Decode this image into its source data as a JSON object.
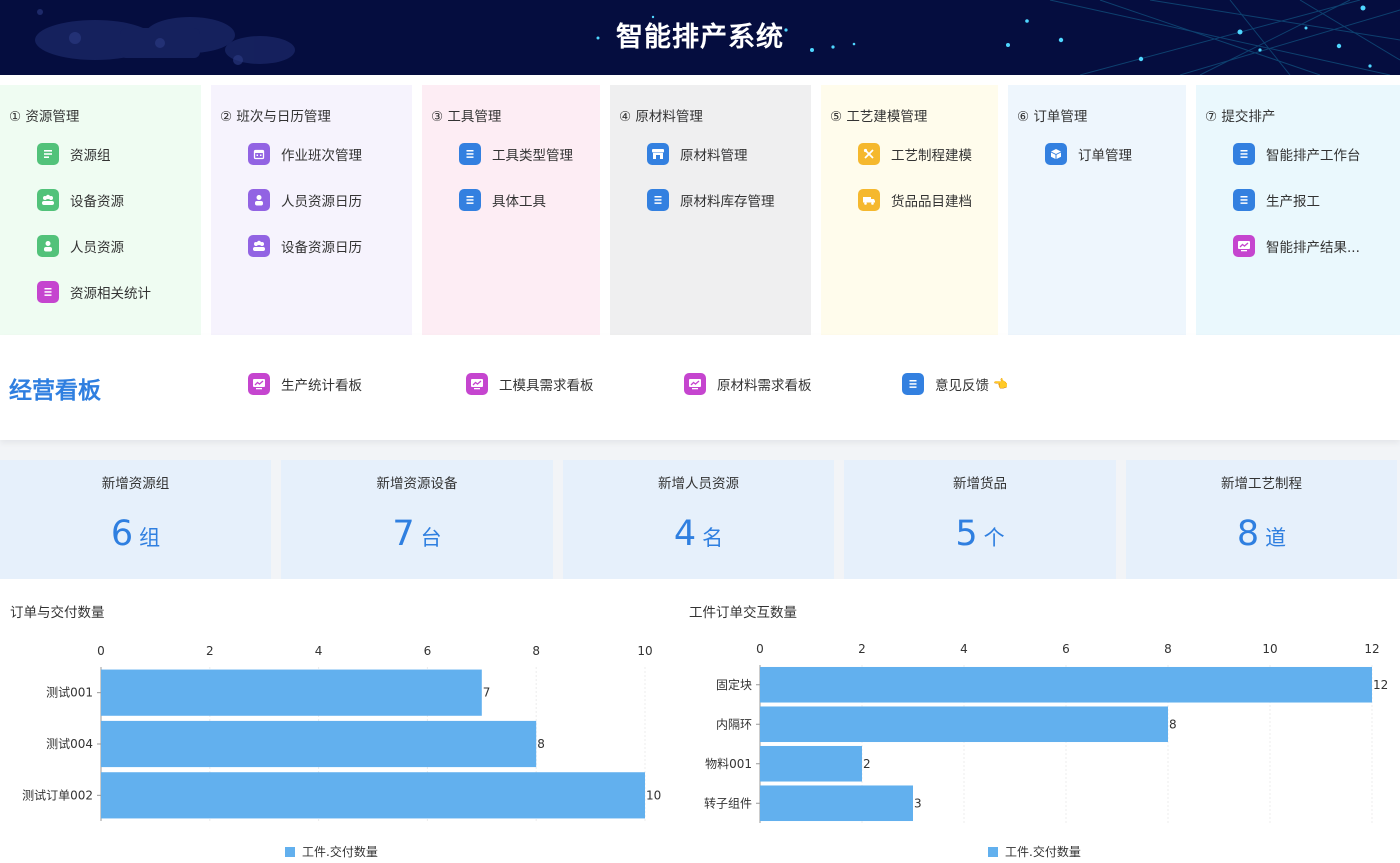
{
  "header": {
    "title": "智能排产系统"
  },
  "modules": [
    {
      "title": "① 资源管理",
      "bg": "#effcf2",
      "items": [
        {
          "label": "资源组",
          "icon": "list-icon",
          "color": "#52c27a"
        },
        {
          "label": "设备资源",
          "icon": "group-icon",
          "color": "#52c27a"
        },
        {
          "label": "人员资源",
          "icon": "person-icon",
          "color": "#52c27a"
        },
        {
          "label": "资源相关统计",
          "icon": "doc-icon",
          "color": "#c545cf"
        }
      ]
    },
    {
      "title": "② 班次与日历管理",
      "bg": "#f6f3fd",
      "items": [
        {
          "label": "作业班次管理",
          "icon": "calendar-icon",
          "color": "#9263e3"
        },
        {
          "label": "人员资源日历",
          "icon": "person-icon",
          "color": "#9263e3"
        },
        {
          "label": "设备资源日历",
          "icon": "group-icon",
          "color": "#9263e3"
        }
      ]
    },
    {
      "title": "③ 工具管理",
      "bg": "#fdedf4",
      "items": [
        {
          "label": "工具类型管理",
          "icon": "doc-icon",
          "color": "#3380e0"
        },
        {
          "label": "具体工具",
          "icon": "doc-icon",
          "color": "#3380e0"
        }
      ]
    },
    {
      "title": "④ 原材料管理",
      "bg": "#efeff0",
      "items": [
        {
          "label": "原材料管理",
          "icon": "store-icon",
          "color": "#3380e0"
        },
        {
          "label": "原材料库存管理",
          "icon": "doc-icon",
          "color": "#3380e0"
        }
      ]
    },
    {
      "title": "⑤ 工艺建模管理",
      "bg": "#fffcec",
      "items": [
        {
          "label": "工艺制程建模",
          "icon": "tools-icon",
          "color": "#f5b82e"
        },
        {
          "label": "货品品目建档",
          "icon": "truck-icon",
          "color": "#f5b82e"
        }
      ]
    },
    {
      "title": "⑥ 订单管理",
      "bg": "#eef6fd",
      "items": [
        {
          "label": "订单管理",
          "icon": "cube-icon",
          "color": "#3380e0"
        }
      ]
    },
    {
      "title": "⑦ 提交排产",
      "bg": "#eaf8fd",
      "items": [
        {
          "label": "智能排产工作台",
          "icon": "doc-icon",
          "color": "#3380e0"
        },
        {
          "label": "生产报工",
          "icon": "doc-icon",
          "color": "#3380e0"
        },
        {
          "label": "智能排产结果...",
          "icon": "monitor-icon",
          "color": "#c545cf"
        }
      ]
    }
  ],
  "board": {
    "title": "经营看板",
    "items": [
      {
        "label": "生产统计看板",
        "icon": "monitor-icon",
        "color": "#c545cf"
      },
      {
        "label": "工模具需求看板",
        "icon": "monitor-icon",
        "color": "#c545cf"
      },
      {
        "label": "原材料需求看板",
        "icon": "monitor-icon",
        "color": "#c545cf"
      },
      {
        "label": "意见反馈",
        "icon": "doc-icon",
        "color": "#3380e0",
        "emoji": "👈"
      }
    ]
  },
  "stats": [
    {
      "label": "新增资源组",
      "value": "6",
      "unit": "组"
    },
    {
      "label": "新增资源设备",
      "value": "7",
      "unit": "台"
    },
    {
      "label": "新增人员资源",
      "value": "4",
      "unit": "名"
    },
    {
      "label": "新增货品",
      "value": "5",
      "unit": "个"
    },
    {
      "label": "新增工艺制程",
      "value": "8",
      "unit": "道"
    }
  ],
  "chart_data": [
    {
      "type": "bar",
      "orientation": "horizontal",
      "title": "订单与交付数量",
      "categories": [
        "测试001",
        "测试004",
        "测试订单002"
      ],
      "series": [
        {
          "name": "工件.交付数量",
          "values": [
            7,
            8,
            10
          ]
        }
      ],
      "xlim": [
        0,
        10
      ],
      "xticks": [
        0,
        2,
        4,
        6,
        8,
        10
      ],
      "color": "#62b0ee",
      "legend": "bottom-center",
      "grid": true
    },
    {
      "type": "bar",
      "orientation": "horizontal",
      "title": "工件订单交互数量",
      "categories": [
        "固定块",
        "内隔环",
        "物料001",
        "转子组件"
      ],
      "series": [
        {
          "name": "工件.交付数量",
          "values": [
            12,
            8,
            2,
            3
          ]
        }
      ],
      "xlim": [
        0,
        12
      ],
      "xticks": [
        0,
        2,
        4,
        6,
        8,
        10,
        12
      ],
      "color": "#62b0ee",
      "legend": "bottom-center",
      "grid": true
    }
  ]
}
